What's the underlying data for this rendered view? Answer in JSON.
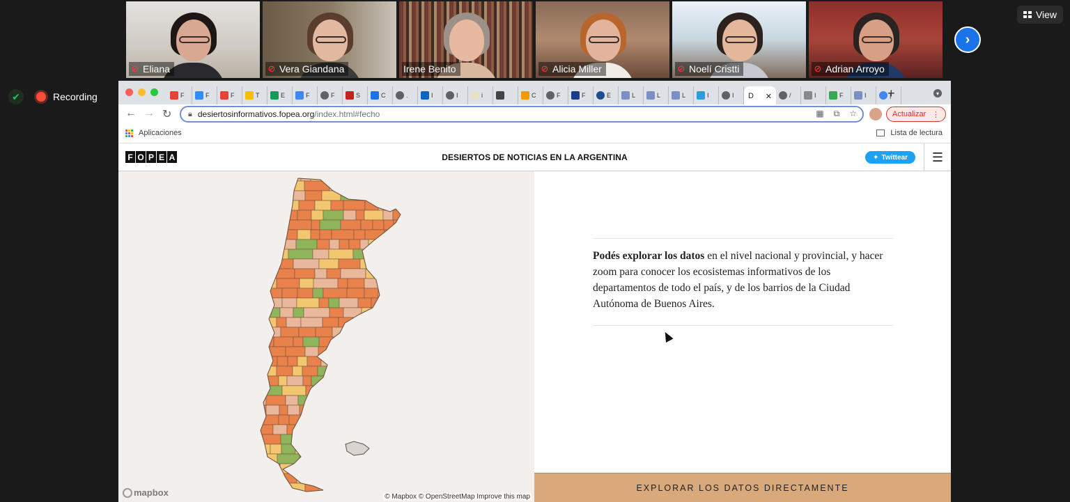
{
  "meeting": {
    "participants": [
      {
        "name": "Eliana",
        "muted": true,
        "active": false
      },
      {
        "name": "Vera Giandana",
        "muted": true,
        "active": false
      },
      {
        "name": "Irene Benito",
        "muted": false,
        "active": true
      },
      {
        "name": "Alicia Miller",
        "muted": true,
        "active": false
      },
      {
        "name": "Noelí Cristti",
        "muted": true,
        "active": false
      },
      {
        "name": "Adrian Arroyo",
        "muted": true,
        "active": false
      }
    ],
    "view_label": "View",
    "recording_label": "Recording"
  },
  "browser": {
    "url_host": "desiertosinformativos.fopea.org",
    "url_path": "/index.html#fecho",
    "update_label": "Actualizar",
    "bookmarks_apps": "Aplicaciones",
    "reading_list": "Lista de lectura",
    "active_tab_label": "D"
  },
  "site": {
    "logo_letters": [
      "F",
      "O",
      "P",
      "E",
      "A"
    ],
    "title": "DESIERTOS DE NOTICIAS EN LA ARGENTINA",
    "tweet_label": "Twittear",
    "intro_bold": "Podés explorar los datos",
    "intro_rest": " en el nivel nacional y provincial, y hacer zoom para conocer los ecosistemas informativos de los departamentos de todo el país, y de los barrios de la Ciudad Autónoma de Buenos Aires.",
    "explore_button": "EXPLORAR LOS DATOS DIRECTAMENTE",
    "map_attribution": "© Mapbox © OpenStreetMap Improve this map",
    "mapbox_logo": "mapbox"
  },
  "colors": {
    "desert": "#e8824a",
    "semi_desert": "#f2c770",
    "moderate": "#e9b79a",
    "non_desert": "#8fb45a",
    "outline": "#6b4a3a"
  }
}
